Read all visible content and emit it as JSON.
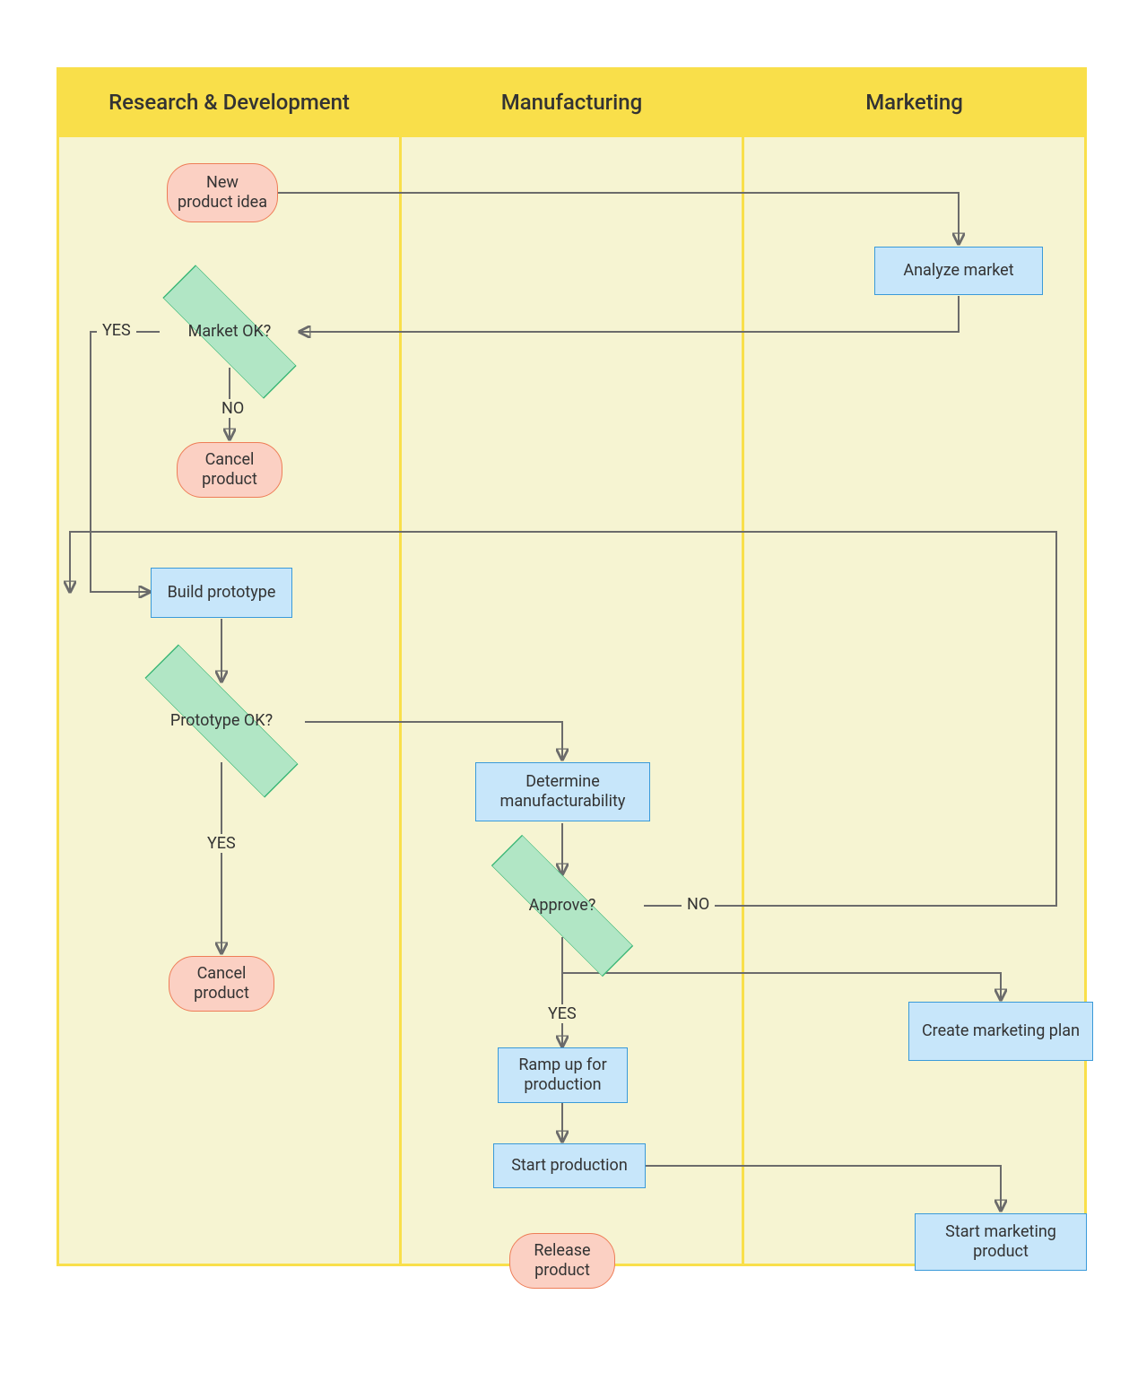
{
  "lanes": {
    "rd": "Research & Development",
    "mfg": "Manufacturing",
    "mkt": "Marketing"
  },
  "nodes": {
    "new_idea": "New product idea",
    "analyze_market": "Analyze market",
    "market_ok": "Market OK?",
    "cancel1": "Cancel product",
    "build_proto": "Build prototype",
    "proto_ok": "Prototype OK?",
    "det_mfg": "Determine manufacturability",
    "cancel2": "Cancel product",
    "approve": "Approve?",
    "create_plan": "Create marketing plan",
    "ramp_up": "Ramp up for production",
    "start_prod": "Start production",
    "start_mkt": "Start marketing product",
    "release": "Release product"
  },
  "labels": {
    "yes1": "YES",
    "no1": "NO",
    "yes2": "YES",
    "yes3": "YES",
    "no3": "NO"
  }
}
